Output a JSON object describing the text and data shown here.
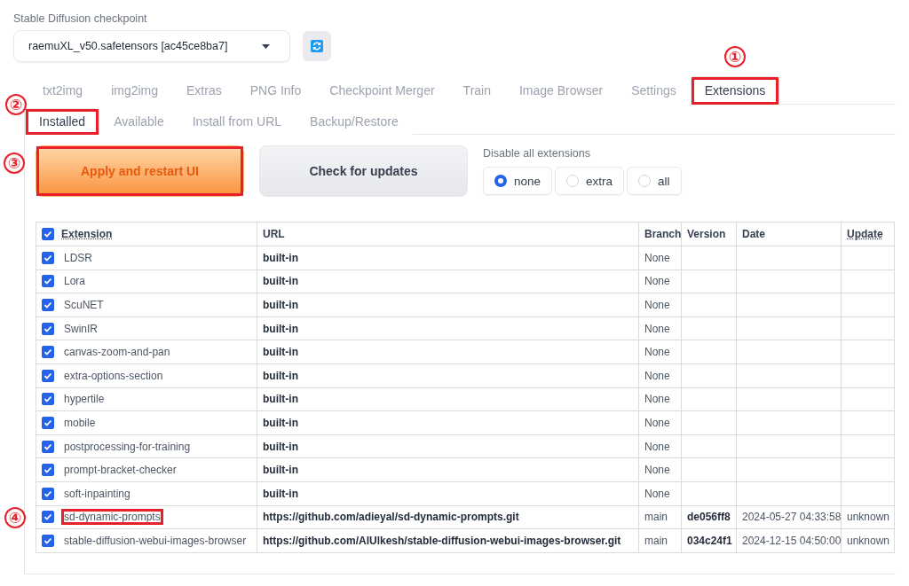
{
  "checkpoint": {
    "label": "Stable Diffusion checkpoint",
    "value": "raemuXL_v50.safetensors [ac45ce8ba7]"
  },
  "tabs": [
    {
      "label": "txt2img",
      "selected": false
    },
    {
      "label": "img2img",
      "selected": false
    },
    {
      "label": "Extras",
      "selected": false
    },
    {
      "label": "PNG Info",
      "selected": false
    },
    {
      "label": "Checkpoint Merger",
      "selected": false
    },
    {
      "label": "Train",
      "selected": false
    },
    {
      "label": "Image Browser",
      "selected": false
    },
    {
      "label": "Settings",
      "selected": false
    },
    {
      "label": "Extensions",
      "selected": true,
      "marker": "①"
    }
  ],
  "subtabs": [
    {
      "label": "Installed",
      "selected": true,
      "marker": "②"
    },
    {
      "label": "Available",
      "selected": false
    },
    {
      "label": "Install from URL",
      "selected": false
    },
    {
      "label": "Backup/Restore",
      "selected": false
    }
  ],
  "buttons": [
    {
      "label": "Apply and restart UI",
      "kind": "primary",
      "marker": "③"
    },
    {
      "label": "Check for updates",
      "kind": "secondary"
    }
  ],
  "disable_all": {
    "label": "Disable all extensions",
    "options": [
      {
        "label": "none",
        "selected": true
      },
      {
        "label": "extra",
        "selected": false
      },
      {
        "label": "all",
        "selected": false
      }
    ]
  },
  "table": {
    "header_checked": true,
    "columns": [
      "Extension",
      "URL",
      "Branch",
      "Version",
      "Date",
      "Update"
    ],
    "rows": [
      {
        "checked": true,
        "extension": "LDSR",
        "url": "built-in",
        "branch": "None"
      },
      {
        "checked": true,
        "extension": "Lora",
        "url": "built-in",
        "branch": "None"
      },
      {
        "checked": true,
        "extension": "ScuNET",
        "url": "built-in",
        "branch": "None"
      },
      {
        "checked": true,
        "extension": "SwinIR",
        "url": "built-in",
        "branch": "None"
      },
      {
        "checked": true,
        "extension": "canvas-zoom-and-pan",
        "url": "built-in",
        "branch": "None"
      },
      {
        "checked": true,
        "extension": "extra-options-section",
        "url": "built-in",
        "branch": "None"
      },
      {
        "checked": true,
        "extension": "hypertile",
        "url": "built-in",
        "branch": "None"
      },
      {
        "checked": true,
        "extension": "mobile",
        "url": "built-in",
        "branch": "None"
      },
      {
        "checked": true,
        "extension": "postprocessing-for-training",
        "url": "built-in",
        "branch": "None"
      },
      {
        "checked": true,
        "extension": "prompt-bracket-checker",
        "url": "built-in",
        "branch": "None"
      },
      {
        "checked": true,
        "extension": "soft-inpainting",
        "url": "built-in",
        "branch": "None"
      },
      {
        "checked": true,
        "extension": "sd-dynamic-prompts",
        "url": "https://github.com/adieyal/sd-dynamic-prompts.git",
        "branch": "main",
        "version": "de056ff8",
        "date": "2024-05-27 04:33:58",
        "update": "unknown",
        "marker": "④"
      },
      {
        "checked": true,
        "extension": "stable-diffusion-webui-images-browser",
        "url": "https://github.com/AlUlkesh/stable-diffusion-webui-images-browser.git",
        "branch": "main",
        "version": "034c24f1",
        "date": "2024-12-15 04:50:00",
        "update": "unknown"
      }
    ]
  }
}
